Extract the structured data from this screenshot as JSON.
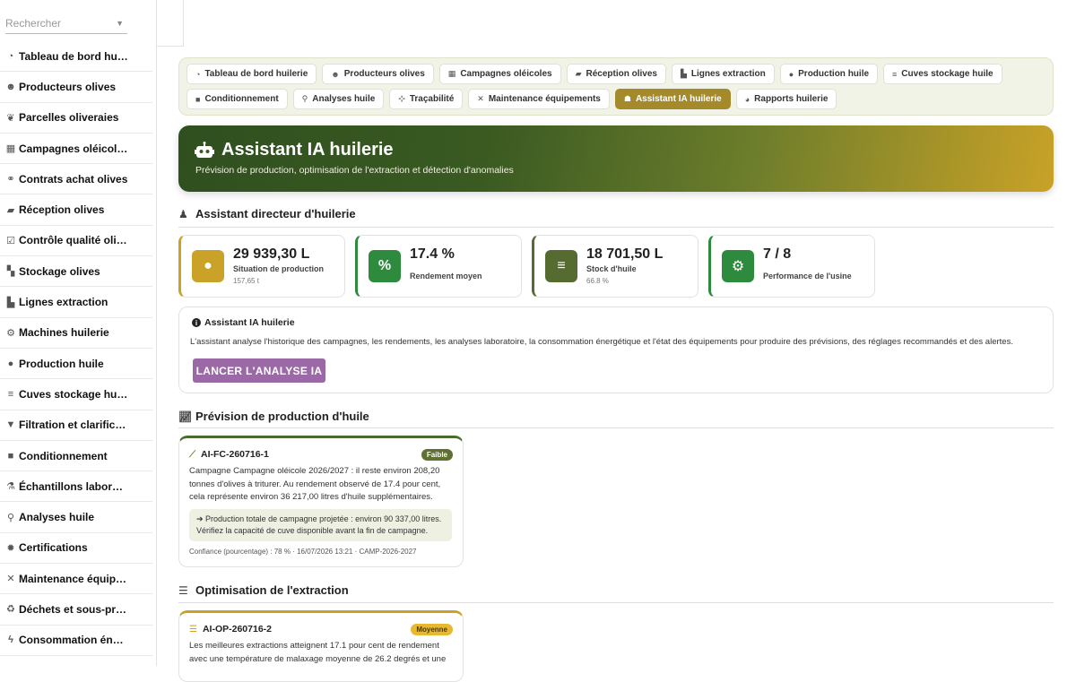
{
  "sidebar": {
    "search_placeholder": "Rechercher",
    "items": [
      {
        "icon": "gauge-icon",
        "label": "Tableau de bord huilerie"
      },
      {
        "icon": "users-icon",
        "label": "Producteurs olives"
      },
      {
        "icon": "seedling-icon",
        "label": "Parcelles oliveraies"
      },
      {
        "icon": "calendar-icon",
        "label": "Campagnes oléicoles"
      },
      {
        "icon": "handshake-icon",
        "label": "Contrats achat olives"
      },
      {
        "icon": "truck-icon",
        "label": "Réception olives"
      },
      {
        "icon": "clipboard-check-icon",
        "label": "Contrôle qualité olives"
      },
      {
        "icon": "boxes-icon",
        "label": "Stockage olives"
      },
      {
        "icon": "industry-icon",
        "label": "Lignes extraction"
      },
      {
        "icon": "cogs-icon",
        "label": "Machines huilerie"
      },
      {
        "icon": "oil-drop-icon",
        "label": "Production huile"
      },
      {
        "icon": "database-icon",
        "label": "Cuves stockage huile"
      },
      {
        "icon": "filter-icon",
        "label": "Filtration et clarification"
      },
      {
        "icon": "box-icon",
        "label": "Conditionnement"
      },
      {
        "icon": "flask-icon",
        "label": "Échantillons laboratoire"
      },
      {
        "icon": "microscope-icon",
        "label": "Analyses huile"
      },
      {
        "icon": "certificate-icon",
        "label": "Certifications"
      },
      {
        "icon": "tools-icon",
        "label": "Maintenance équipements"
      },
      {
        "icon": "recycle-icon",
        "label": "Déchets et sous-produits"
      },
      {
        "icon": "bolt-icon",
        "label": "Consommation énergie"
      }
    ]
  },
  "nav": {
    "row1": [
      {
        "icon": "gauge-icon",
        "label": "Tableau de bord huilerie"
      },
      {
        "icon": "users-icon",
        "label": "Producteurs olives"
      },
      {
        "icon": "calendar-icon",
        "label": "Campagnes oléicoles"
      },
      {
        "icon": "truck-icon",
        "label": "Réception olives"
      },
      {
        "icon": "industry-icon",
        "label": "Lignes extraction"
      },
      {
        "icon": "oil-drop-icon",
        "label": "Production huile"
      },
      {
        "icon": "database-icon",
        "label": "Cuves stockage huile"
      }
    ],
    "row2": [
      {
        "icon": "box-icon",
        "label": "Conditionnement"
      },
      {
        "icon": "microscope-icon",
        "label": "Analyses huile"
      },
      {
        "icon": "sitemap-icon",
        "label": "Traçabilité"
      },
      {
        "icon": "tools-icon",
        "label": "Maintenance équipements"
      },
      {
        "icon": "robot-icon",
        "label": "Assistant IA huilerie",
        "active": true
      },
      {
        "icon": "chart-pie-icon",
        "label": "Rapports huilerie"
      }
    ]
  },
  "hero": {
    "title": "Assistant IA huilerie",
    "subtitle": "Prévision de production, optimisation de l'extraction et détection d'anomalies",
    "gradient_start": "#2f4f1f",
    "gradient_end": "#c9a227"
  },
  "director": {
    "title": "Assistant directeur d'huilerie",
    "stats": [
      {
        "icon": "oil-drop-icon",
        "value": "29 939,30 L",
        "label": "Situation de production",
        "sub": "157,65 t",
        "color": "#c9a227"
      },
      {
        "icon": "percent-icon",
        "value": "17.4 %",
        "label": "Rendement moyen",
        "sub": "",
        "color": "#2e8b3e"
      },
      {
        "icon": "database-icon",
        "value": "18 701,50 L",
        "label": "Stock d'huile",
        "sub": "66.8 %",
        "color": "#556b2f"
      },
      {
        "icon": "cogs-icon",
        "value": "7 / 8",
        "label": "Performance de l'usine",
        "sub": "",
        "color": "#2e8b3e"
      }
    ]
  },
  "ai_panel": {
    "title": "Assistant IA huilerie",
    "description": "L'assistant analyse l'historique des campagnes, les rendements, les analyses laboratoire, la consommation énergétique et l'état des équipements pour produire des prévisions, des réglages recommandés et des alertes.",
    "button": "LANCER L'ANALYSE IA"
  },
  "forecast": {
    "title": "Prévision de production d'huile",
    "card": {
      "id": "AI-FC-260716-1",
      "badge": "Faible",
      "body": "Campagne Campagne oléicole 2026/2027 : il reste environ 208,20 tonnes d'olives à triturer. Au rendement observé de 17.4 pour cent, cela représente environ 36 217,00 litres d'huile supplémentaires.",
      "recommendation": "Production totale de campagne projetée : environ 90 337,00 litres. Vérifiez la capacité de cuve disponible avant la fin de campagne.",
      "meta": "Confiance (pourcentage) : 78 % · 16/07/2026 13:21 · CAMP-2026-2027"
    }
  },
  "optimisation": {
    "title": "Optimisation de l'extraction",
    "card": {
      "id": "AI-OP-260716-2",
      "badge": "Moyenne",
      "body": "Les meilleures extractions atteignent 17.1 pour cent de rendement avec une température de malaxage moyenne de 26.2 degrés et une"
    }
  }
}
